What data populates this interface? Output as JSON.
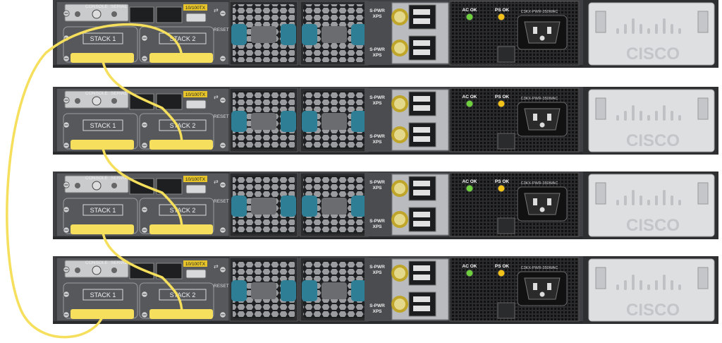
{
  "switches": [
    {
      "console": "CONSOLE",
      "serial": "SERIAL",
      "mgmt": "10/100TX",
      "reset": "RESET",
      "stack1": "STACK 1",
      "stack2": "STACK 2",
      "spwr": "S-PWR",
      "xps": "XPS",
      "spwr2": "S-PWR",
      "xps2": "XPS",
      "ac_ok": "AC OK",
      "ps_ok": "PS OK",
      "psu_model": "C3KX-PWR-350WAC",
      "brand": "CISCO"
    },
    {
      "console": "CONSOLE",
      "serial": "SERIAL",
      "mgmt": "10/100TX",
      "reset": "RESET",
      "stack1": "STACK 1",
      "stack2": "STACK 2",
      "spwr": "S-PWR",
      "xps": "XPS",
      "spwr2": "S-PWR",
      "xps2": "XPS",
      "ac_ok": "AC OK",
      "ps_ok": "PS OK",
      "psu_model": "C3KX-PWR-350WAC",
      "brand": "CISCO"
    },
    {
      "console": "CONSOLE",
      "serial": "SERIAL",
      "mgmt": "10/100TX",
      "reset": "RESET",
      "stack1": "STACK 1",
      "stack2": "STACK 2",
      "spwr": "S-PWR",
      "xps": "XPS",
      "spwr2": "S-PWR",
      "xps2": "XPS",
      "ac_ok": "AC OK",
      "ps_ok": "PS OK",
      "psu_model": "C3KX-PWR-350WAC",
      "brand": "CISCO"
    },
    {
      "console": "CONSOLE",
      "serial": "SERIAL",
      "mgmt": "10/100TX",
      "reset": "RESET",
      "stack1": "STACK 1",
      "stack2": "STACK 2",
      "spwr": "S-PWR",
      "xps": "XPS",
      "spwr2": "S-PWR",
      "xps2": "XPS",
      "ac_ok": "AC OK",
      "ps_ok": "PS OK",
      "psu_model": "C3KX-PWR-350WAC",
      "brand": "CISCO"
    }
  ],
  "colors": {
    "cable": "#f5df5c",
    "chassis": "#3d3f42",
    "panel": "#56585b",
    "fan_blade": "#2e7f95",
    "led_green": "#6fcf3f",
    "led_yellow": "#f2c21b"
  }
}
